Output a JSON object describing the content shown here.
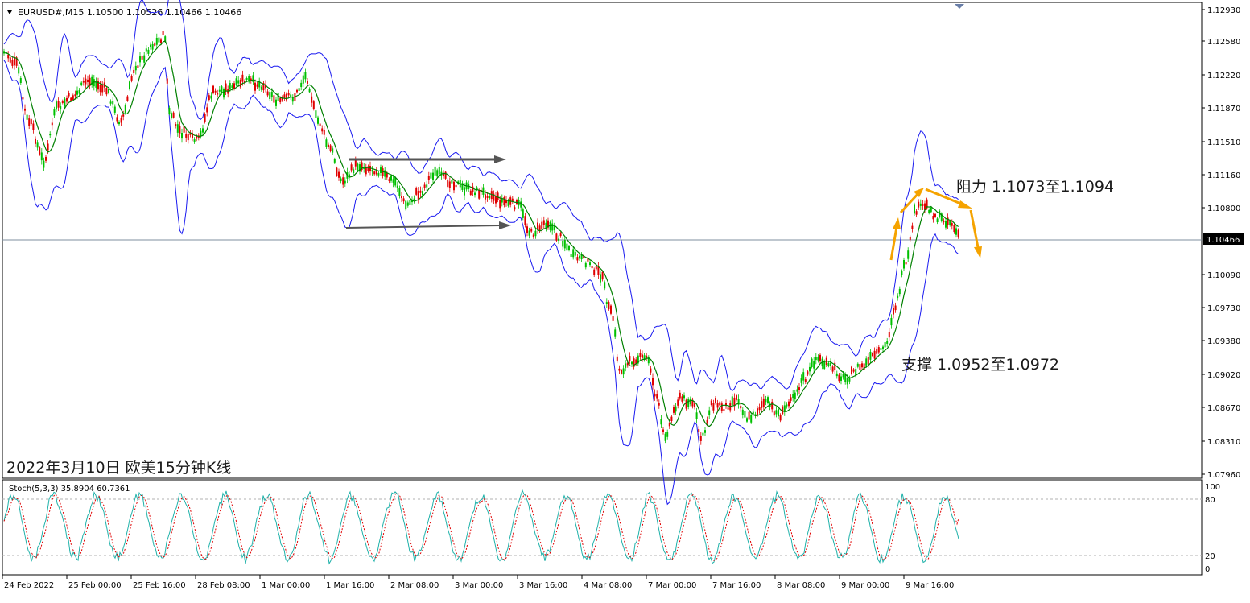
{
  "header": {
    "symbol_line": "EURUSD#,M15  1.10500 1.10526 1.10466 1.10466"
  },
  "chart_title": "2022年3月10日 欧美15分钟K线",
  "annotations": {
    "resistance": "阻力 1.1073至1.1094",
    "support": "支撑 1.0952至1.0972"
  },
  "price_axis": {
    "ticks": [
      "1.12930",
      "1.12580",
      "1.12220",
      "1.11870",
      "1.11510",
      "1.11160",
      "1.10800",
      "1.10090",
      "1.09730",
      "1.09380",
      "1.09020",
      "1.08670",
      "1.08310",
      "1.07960"
    ],
    "current_price_label": "1.10466"
  },
  "stoch": {
    "label": "Stoch(5,3,3) 35.8904 60.7361",
    "ticks": [
      "100",
      "80",
      "20",
      "0"
    ]
  },
  "time_axis": {
    "labels": [
      "24 Feb 2022",
      "25 Feb 00:00",
      "25 Feb 16:00",
      "28 Feb 08:00",
      "1 Mar 00:00",
      "1 Mar 16:00",
      "2 Mar 08:00",
      "3 Mar 00:00",
      "3 Mar 16:00",
      "4 Mar 08:00",
      "7 Mar 00:00",
      "7 Mar 16:00",
      "8 Mar 08:00",
      "9 Mar 00:00",
      "9 Mar 16:00"
    ]
  },
  "colors": {
    "band": "#1a1af0",
    "bull_candle": "#00c000",
    "bear_candle": "#e00000",
    "ma": "#008000",
    "arrow_gray": "#555555",
    "arrow_orange": "#f5a300",
    "stoch_main": "#20b2aa",
    "stoch_signal": "#e00000"
  },
  "chart_data": {
    "type": "line",
    "title": "2022年3月10日 欧美15分钟K线",
    "symbol": "EURUSD#",
    "timeframe": "M15",
    "ohlc_last": {
      "open": 1.105,
      "high": 1.10526,
      "low": 1.10466,
      "close": 1.10466
    },
    "current_price": 1.10466,
    "ylim": [
      1.079,
      1.13
    ],
    "x": [
      "24 Feb 2022",
      "25 Feb 00:00",
      "25 Feb 16:00",
      "28 Feb 08:00",
      "1 Mar 00:00",
      "1 Mar 16:00",
      "2 Mar 08:00",
      "3 Mar 00:00",
      "3 Mar 16:00",
      "4 Mar 08:00",
      "7 Mar 00:00",
      "7 Mar 16:00",
      "8 Mar 08:00",
      "9 Mar 00:00",
      "9 Mar 16:00"
    ],
    "series": [
      {
        "values": [
          1.124,
          1.119,
          1.127,
          1.1195,
          1.121,
          1.1135,
          1.1095,
          1.106,
          1.1055,
          1.089,
          1.086,
          1.086,
          1.089,
          1.094,
          1.1075
        ]
      }
    ],
    "resistance_range": [
      1.1073,
      1.1094
    ],
    "support_range": [
      1.0952,
      1.0972
    ],
    "stochastic": {
      "params": "5,3,3",
      "main": 35.8904,
      "signal": 60.7361,
      "levels": [
        80,
        20
      ],
      "ylim": [
        0,
        100
      ]
    }
  }
}
